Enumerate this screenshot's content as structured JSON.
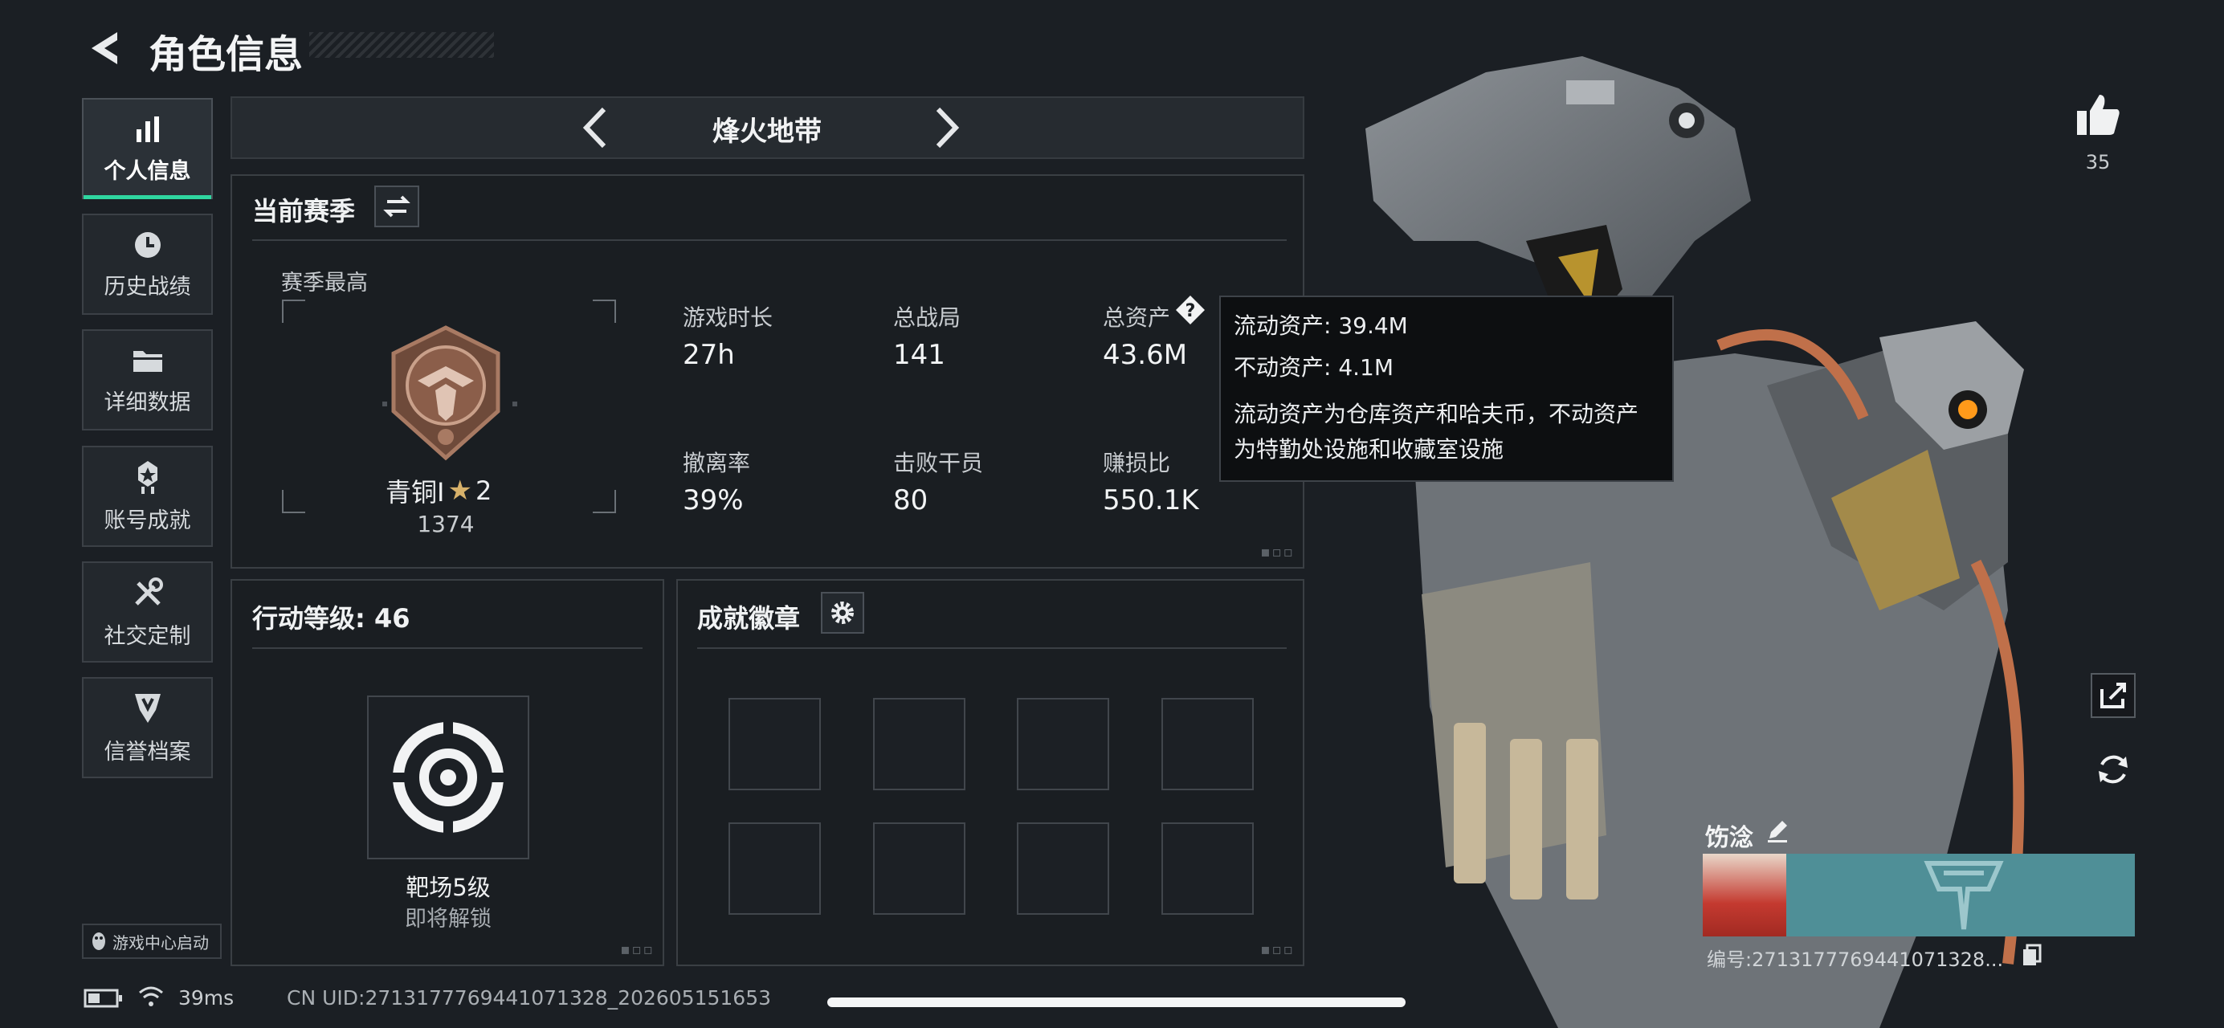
{
  "header": {
    "title": "角色信息"
  },
  "nav": {
    "items": [
      {
        "label": "个人信息"
      },
      {
        "label": "历史战绩"
      },
      {
        "label": "详细数据"
      },
      {
        "label": "账号成就"
      },
      {
        "label": "社交定制"
      },
      {
        "label": "信誉档案"
      }
    ],
    "launch_label": "游戏中心启动"
  },
  "mode": {
    "name": "烽火地带"
  },
  "season": {
    "title": "当前赛季",
    "best_label": "赛季最高",
    "rank_name": "青铜I",
    "rank_stars": "2",
    "rank_score": "1374",
    "stats": [
      {
        "label": "游戏时长",
        "value": "27h"
      },
      {
        "label": "总战局",
        "value": "141"
      },
      {
        "label": "总资产",
        "value": "43.6M"
      },
      {
        "label": "撤离率",
        "value": "39%"
      },
      {
        "label": "击败干员",
        "value": "80"
      },
      {
        "label": "赚损比",
        "value": "550.1K"
      }
    ]
  },
  "tooltip": {
    "line1": "流动资产: 39.4M",
    "line2": "不动资产: 4.1M",
    "desc1": "流动资产为仓库资产和哈夫币，不动资产",
    "desc2": "为特勤处设施和收藏室设施"
  },
  "action_level": {
    "title": "行动等级: 46",
    "item_name": "靶场5级",
    "item_status": "即将解锁"
  },
  "achievements": {
    "title": "成就徽章",
    "slots": 8
  },
  "player": {
    "likes": "35",
    "name": "饬淰",
    "id_text": "编号:2713177769441071328..."
  },
  "status_bar": {
    "ping": "39ms",
    "uid": "CN UID:2713177769441071328_202605151653"
  },
  "colors": {
    "accent": "#2fd6a0",
    "panel_bg": "#1a1e22",
    "border": "#3a3f44",
    "banner": "#4f8f97"
  }
}
